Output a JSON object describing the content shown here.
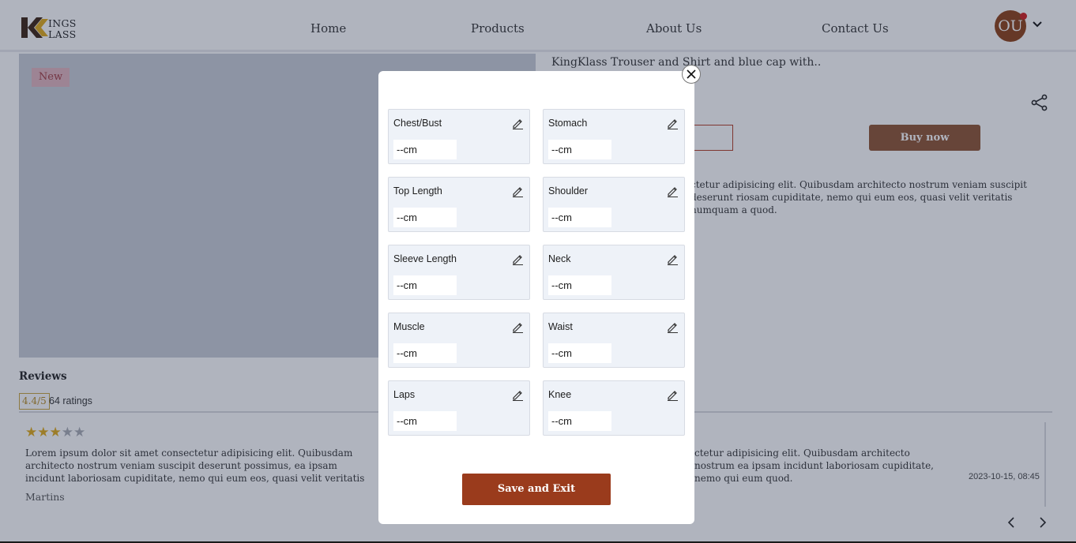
{
  "brand": {
    "logo_line1": "INGS",
    "logo_line2": "LASS"
  },
  "nav": {
    "items": [
      "Home",
      "Products",
      "About Us",
      "Contact Us"
    ]
  },
  "user": {
    "initials": "OU"
  },
  "product": {
    "badge": "New",
    "title": "KingKlass Trouser and Shirt and blue cap with..",
    "buy_label": "Buy now",
    "description": "ctetur adipisicing elit. Quibusdam architecto nostrum veniam suscipit deserunt riosam cupiditate, nemo qui eum eos, quasi velit veritatis numquam a quod."
  },
  "reviews": {
    "title": "Reviews",
    "rating": "4.4/5",
    "count_label": "64 ratings",
    "stars_filled": 3,
    "stars_total": 5,
    "text": "Lorem ipsum dolor sit amet consectetur adipisicing elit. Quibusdam architecto nostrum veniam suscipit deserunt possimus, ea ipsam incidunt laboriosam cupiditate, nemo qui eum eos, quasi velit veritatis numquam a quod.",
    "text_right": "ctetur adipisicing elit. Quibusdam architecto nostrum ea ipsam incidunt laboriosam cupiditate, nemo qui eum quod.",
    "author": "Martins",
    "date": "2023-10-15, 08:45"
  },
  "modal": {
    "fields": [
      {
        "label": "Chest/Bust",
        "value": "--cm"
      },
      {
        "label": "Stomach",
        "value": "--cm"
      },
      {
        "label": "Top Length",
        "value": "--cm"
      },
      {
        "label": "Shoulder",
        "value": "--cm"
      },
      {
        "label": "Sleeve Length",
        "value": "--cm"
      },
      {
        "label": "Neck",
        "value": "--cm"
      },
      {
        "label": "Muscle",
        "value": "--cm"
      },
      {
        "label": "Waist",
        "value": "--cm"
      },
      {
        "label": "Laps",
        "value": "--cm"
      },
      {
        "label": "Knee",
        "value": "--cm"
      }
    ],
    "save_label": "Save and Exit"
  },
  "colors": {
    "brand_brown": "#8c3e14",
    "save_button": "#9a3b1c",
    "star": "#e0a917"
  },
  "icons": {
    "close": "close-icon",
    "edit": "pencil-icon",
    "share": "share-icon",
    "chevron": "chevron-down-icon"
  }
}
